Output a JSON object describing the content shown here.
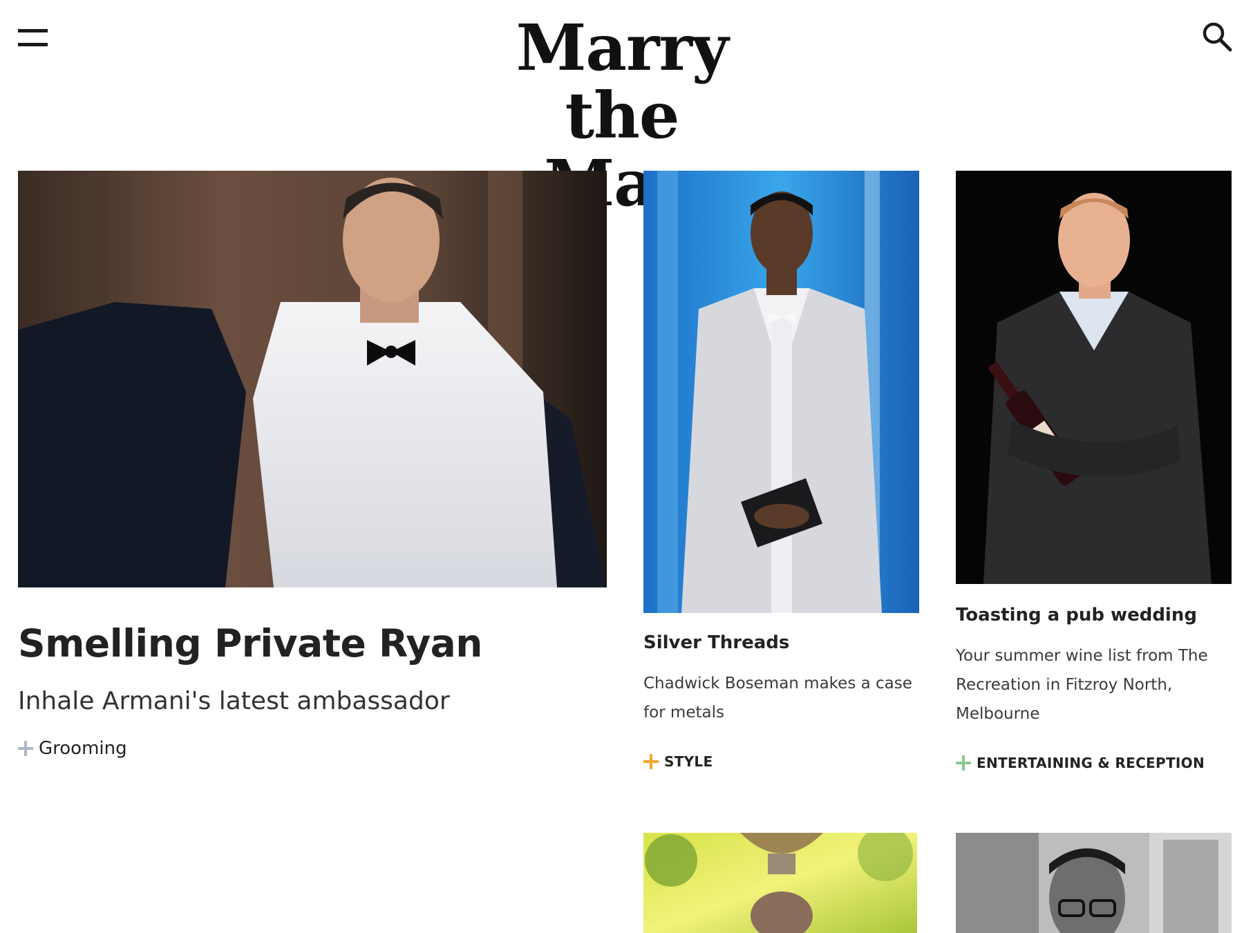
{
  "header": {
    "logo_line1": "Marry",
    "logo_line2": "the Man",
    "menu_icon": "hamburger-menu-icon",
    "search_icon": "search-icon"
  },
  "feature": {
    "image_alt": "Man in white shirt and bow tie removing a black tuxedo jacket",
    "title": "Smelling Private Ryan",
    "subtitle": "Inhale Armani's latest ambassador",
    "tag": "Grooming",
    "tag_color": "#aab6c9"
  },
  "cards": [
    {
      "image_alt": "Man in silver patterned tuxedo holding an envelope on stage",
      "title": "Silver Threads",
      "description": "Chadwick Boseman makes a case for metals",
      "tag": "STYLE",
      "tag_color": "#f2a730"
    },
    {
      "image_alt": "Smiling man in dark suit holding a wine bottle",
      "title": "Toasting a pub wedding",
      "description": "Your summer wine list from The Recreation in Fitzroy North, Melbourne",
      "tag": "ENTERTAINING & RECEPTION",
      "tag_color": "#8cc891"
    }
  ],
  "more_cards": [
    {
      "image_alt": "Outdoor garden photo with a fountain"
    },
    {
      "image_alt": "Black and white photo of smiling man with glasses"
    }
  ]
}
